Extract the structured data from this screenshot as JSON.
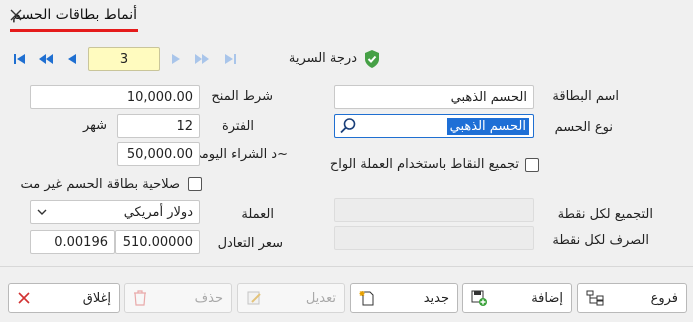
{
  "window": {
    "title": "أنماط بطاقات الحسم"
  },
  "nav": {
    "page_value": "3"
  },
  "security": {
    "label": "درجة السرية"
  },
  "form": {
    "card_name_label": "اسم البطاقة",
    "card_name_value": "الحسم الذهبي",
    "discount_type_label": "نوع الحسم",
    "discount_type_value": "الحسم الذهبي",
    "grant_condition_label": "شرط المنح",
    "grant_condition_value": "10,000.00",
    "period_label": "الفترة",
    "period_value": "12",
    "period_unit": "شهر",
    "daily_purchase_label": "~د الشراء اليومي",
    "daily_purchase_value": "50,000.00",
    "collect_points_label": "تجميع النقاط باستخدام العملة الواح",
    "validity_label": "صلاحية بطاقة الحسم غير مت",
    "collect_per_point_label": "التجميع لكل نقطة",
    "spend_per_point_label": "الصرف لكل نقطة",
    "currency_label": "العملة",
    "currency_value": "دولار أمريكي",
    "exchange_rate_label": "سعر التعادل",
    "exchange_rate_value": "510.00000",
    "exchange_rate_small": "0.00196"
  },
  "buttons": {
    "branches": "فروع",
    "add": "إضافة",
    "new": "جديد",
    "edit": "تعديل",
    "delete": "حذف",
    "close": "إغلاق"
  },
  "colors": {
    "accent": "#1f6fd1",
    "title_underline": "#e51b1b",
    "page_field": "#fffbbf",
    "selection": "#1e6fd6"
  }
}
